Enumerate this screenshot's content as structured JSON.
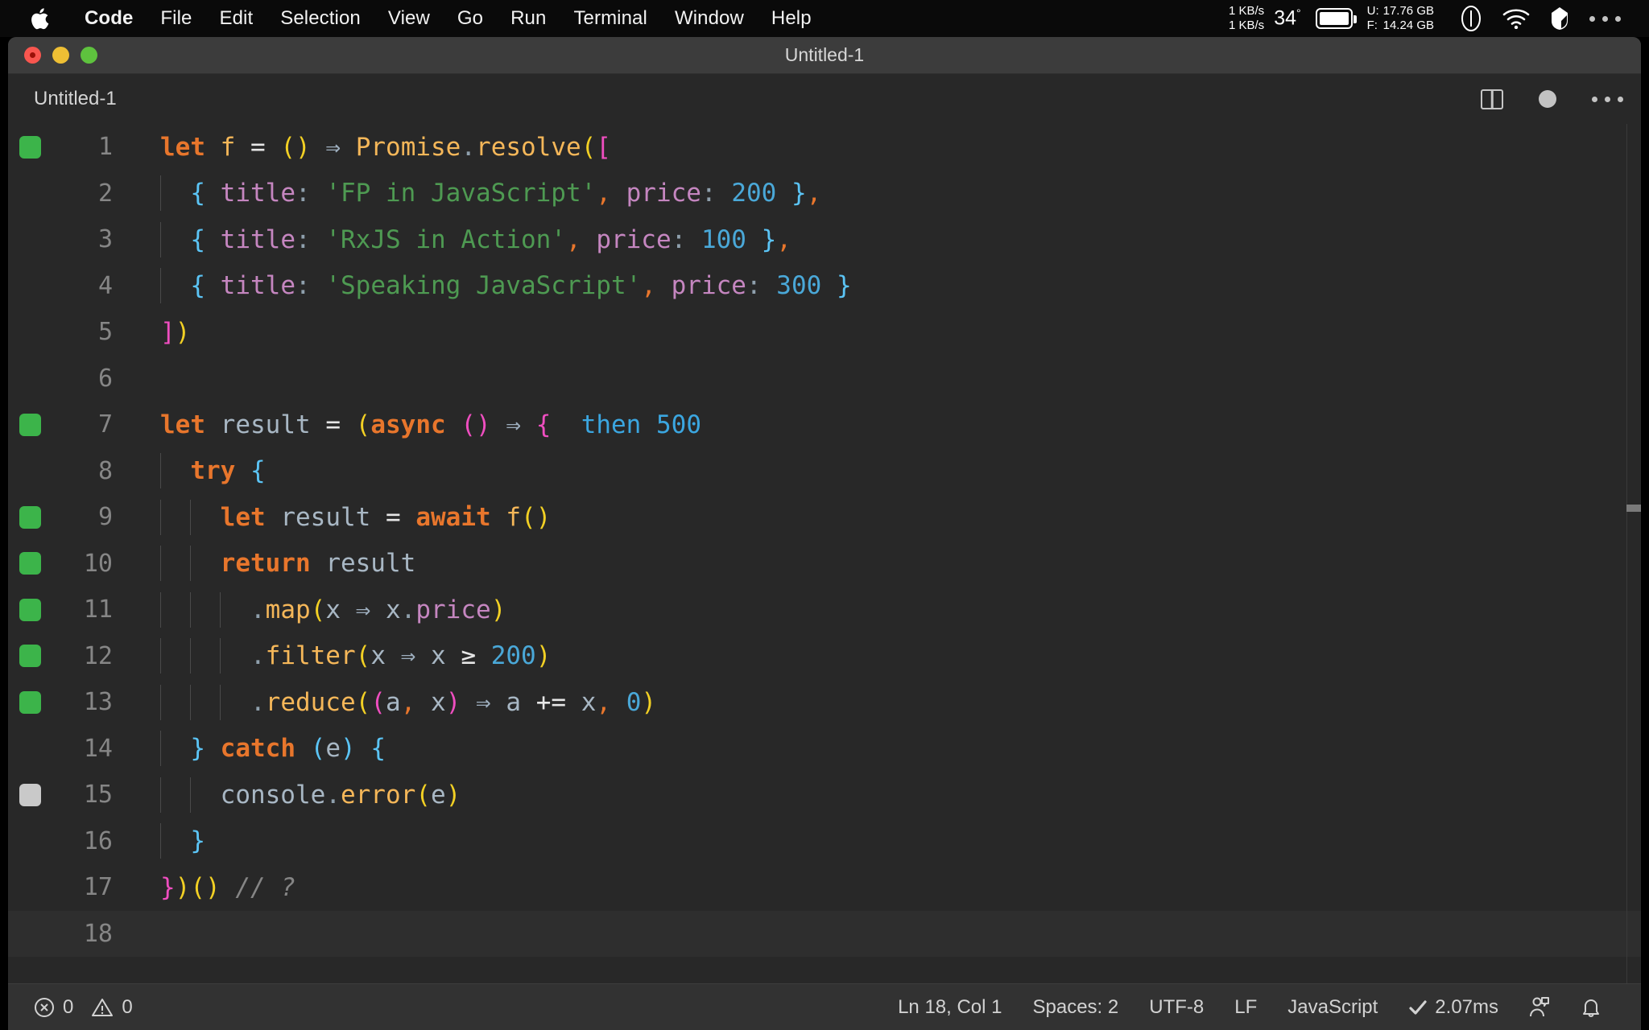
{
  "menubar": {
    "apple_icon": "apple-logo",
    "items": [
      {
        "label": "Code",
        "bold": true
      },
      {
        "label": "File",
        "bold": false
      },
      {
        "label": "Edit",
        "bold": false
      },
      {
        "label": "Selection",
        "bold": false
      },
      {
        "label": "View",
        "bold": false
      },
      {
        "label": "Go",
        "bold": false
      },
      {
        "label": "Run",
        "bold": false
      },
      {
        "label": "Terminal",
        "bold": false
      },
      {
        "label": "Window",
        "bold": false
      },
      {
        "label": "Help",
        "bold": false
      }
    ],
    "status": {
      "net_up": "1 KB/s",
      "net_down": "1 KB/s",
      "temperature": "34",
      "temp_unit": "°",
      "battery_icon": "battery-icon",
      "disk_used_label": "U:",
      "disk_used": "17.76 GB",
      "disk_free_label": "F:",
      "disk_free": "14.24 GB",
      "gauge_icon": "gauge-icon",
      "wifi_icon": "wifi-icon",
      "shield_icon": "shield-icon",
      "more_icon": "ellipsis-icon"
    }
  },
  "window": {
    "title": "Untitled-1",
    "traffic": {
      "close": "close-button",
      "minimize": "minimize-button",
      "zoom": "zoom-button"
    }
  },
  "tabs": {
    "items": [
      {
        "label": "Untitled-1",
        "active": true
      }
    ],
    "actions": {
      "split_editor": "split-editor-icon",
      "unsaved_indicator": "unsaved-dot-icon",
      "more_actions": "more-actions-icon"
    }
  },
  "editor": {
    "language": "JavaScript",
    "lines": [
      {
        "n": "1",
        "cov": "hit",
        "indents": 0
      },
      {
        "n": "2",
        "cov": null,
        "indents": 1
      },
      {
        "n": "3",
        "cov": null,
        "indents": 1
      },
      {
        "n": "4",
        "cov": null,
        "indents": 1
      },
      {
        "n": "5",
        "cov": null,
        "indents": 0
      },
      {
        "n": "6",
        "cov": null,
        "indents": 0
      },
      {
        "n": "7",
        "cov": "hit",
        "indents": 0
      },
      {
        "n": "8",
        "cov": null,
        "indents": 1
      },
      {
        "n": "9",
        "cov": "hit",
        "indents": 2
      },
      {
        "n": "10",
        "cov": "hit",
        "indents": 2
      },
      {
        "n": "11",
        "cov": "hit",
        "indents": 3
      },
      {
        "n": "12",
        "cov": "hit",
        "indents": 3
      },
      {
        "n": "13",
        "cov": "hit",
        "indents": 3
      },
      {
        "n": "14",
        "cov": null,
        "indents": 1
      },
      {
        "n": "15",
        "cov": "miss",
        "indents": 2
      },
      {
        "n": "16",
        "cov": null,
        "indents": 1
      },
      {
        "n": "17",
        "cov": null,
        "indents": 0
      },
      {
        "n": "18",
        "cov": null,
        "indents": 0,
        "current": true
      }
    ],
    "source_text": [
      "let f = () ⇒ Promise.resolve([",
      "  { title: 'FP in JavaScript', price: 200 },",
      "  { title: 'RxJS in Action', price: 100 },",
      "  { title: 'Speaking JavaScript', price: 300 }",
      "])",
      "",
      "let result = (async () ⇒ {",
      "  try {",
      "    let result = await f()",
      "    return result",
      "      .map(x ⇒ x.price)",
      "      .filter(x ≥ 200)",
      "      .reduce((a, x) ⇒ a += x, 0)",
      "  } catch (e) {",
      "    console.error(e)",
      "  }",
      "})() // ?",
      ""
    ],
    "inline_annotation": {
      "line": 7,
      "text": "then 500"
    },
    "strings": [
      "'FP in JavaScript'",
      "'RxJS in Action'",
      "'Speaking JavaScript'"
    ],
    "numbers": [
      "200",
      "100",
      "300",
      "500",
      "200",
      "0"
    ],
    "comment": "// ?"
  },
  "statusbar": {
    "errors_icon": "error-circle-icon",
    "errors": "0",
    "warnings_icon": "warning-triangle-icon",
    "warnings": "0",
    "cursor": "Ln 18, Col 1",
    "indent": "Spaces: 2",
    "encoding": "UTF-8",
    "eol": "LF",
    "language": "JavaScript",
    "runtime_icon": "check-icon",
    "runtime": "2.07ms",
    "feedback_icon": "feedback-icon",
    "bell_icon": "bell-icon"
  },
  "colors": {
    "editor_bg": "#282828",
    "titlebar_bg": "#3c3c3c",
    "statusbar_bg": "#323232",
    "coverage_hit": "#3cb44a",
    "coverage_miss": "#c9c9c9",
    "keyword": "#e8762c",
    "string": "#4e9a52",
    "number": "#4aa8d8",
    "function": "#f5b759",
    "property": "#c586c0",
    "paren": "#f2d024",
    "bracket": "#ef4ec0",
    "brace": "#5bc4f5",
    "comment": "#858585"
  }
}
